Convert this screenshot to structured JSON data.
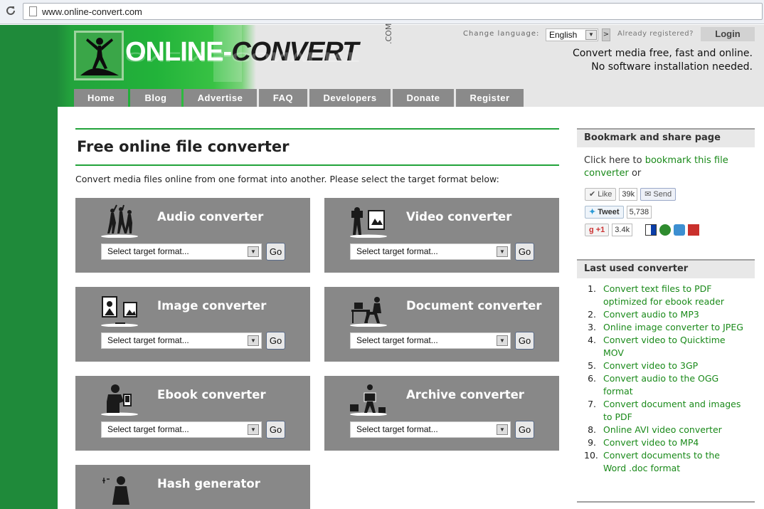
{
  "browser": {
    "url": "www.online-convert.com"
  },
  "logo": {
    "word1": "ONLINE-",
    "word2": "CONVERT",
    "suffix": ".COM"
  },
  "header": {
    "change_language_label": "Change language:",
    "language_selected": "English",
    "language_go": ">",
    "already_registered": "Already registered?",
    "login_label": "Login",
    "tagline_line1": "Convert media free, fast and online.",
    "tagline_line2": "No software installation needed."
  },
  "nav": [
    "Home",
    "Blog",
    "Advertise",
    "FAQ",
    "Developers",
    "Donate",
    "Register"
  ],
  "main": {
    "title": "Free online file converter",
    "intro": "Convert media files online from one format into another. Please select the target format below:",
    "select_placeholder": "Select target format...",
    "go_label": "Go",
    "cards": [
      {
        "title": "Audio converter",
        "icon": "dancers-icon"
      },
      {
        "title": "Video converter",
        "icon": "camera-operator-icon"
      },
      {
        "title": "Image converter",
        "icon": "photo-frames-icon"
      },
      {
        "title": "Document converter",
        "icon": "desk-worker-icon"
      },
      {
        "title": "Ebook converter",
        "icon": "ebook-reader-icon"
      },
      {
        "title": "Archive converter",
        "icon": "box-carrier-icon"
      },
      {
        "title": "Hash generator",
        "icon": "hash-person-icon"
      }
    ]
  },
  "sidebar": {
    "bookmark": {
      "title": "Bookmark and share page",
      "text_before": "Click here to ",
      "link": "bookmark this file converter",
      "text_after": " or",
      "like_label": "Like",
      "like_count": "39k",
      "send_label": "Send",
      "tweet_label": "Tweet",
      "tweet_count": "5,738",
      "plusone_label": "+1",
      "plusone_count": "3.4k"
    },
    "last_used": {
      "title": "Last used converter",
      "items": [
        {
          "num": "1.",
          "lines": [
            "Convert text files to PDF",
            "optimized for ebook reader"
          ]
        },
        {
          "num": "2.",
          "lines": [
            "Convert audio to MP3"
          ]
        },
        {
          "num": "3.",
          "lines": [
            "Online image converter to JPEG"
          ]
        },
        {
          "num": "4.",
          "lines": [
            "Convert video to Quicktime",
            "MOV"
          ]
        },
        {
          "num": "5.",
          "lines": [
            "Convert video to 3GP"
          ]
        },
        {
          "num": "6.",
          "lines": [
            "Convert audio to the OGG",
            "format"
          ]
        },
        {
          "num": "7.",
          "lines": [
            "Convert document and images",
            "to PDF"
          ]
        },
        {
          "num": "8.",
          "lines": [
            "Online AVI video converter"
          ]
        },
        {
          "num": "9.",
          "lines": [
            "Convert video to MP4"
          ]
        },
        {
          "num": "10.",
          "lines": [
            "Convert documents to the",
            "Word .doc format"
          ]
        }
      ]
    }
  },
  "colors": {
    "brand_green": "#22a33a",
    "card_grey": "#888888",
    "link_green": "#1a8a1a",
    "nav_grey": "#8a8a8a"
  }
}
